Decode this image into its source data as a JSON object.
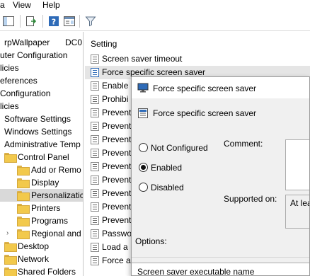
{
  "menu": {
    "items": [
      "a",
      "View",
      "Help"
    ]
  },
  "tree": {
    "items": [
      {
        "label": "rpWallpaper",
        "suffix": "DC0",
        "indent": 0
      },
      {
        "label": "uter Configuration",
        "indent": 0
      },
      {
        "label": "licies",
        "indent": 0
      },
      {
        "label": "eferences",
        "indent": 0
      },
      {
        "label": "Configuration",
        "indent": 0
      },
      {
        "label": "licies",
        "indent": 0
      },
      {
        "label": "Software Settings",
        "indent": 1
      },
      {
        "label": "Windows Settings",
        "indent": 1
      },
      {
        "label": "Administrative Temp",
        "indent": 1
      },
      {
        "label": "Control Panel",
        "indent": 2
      },
      {
        "label": "Add or Remo",
        "indent": 3
      },
      {
        "label": "Display",
        "indent": 3
      },
      {
        "label": "Personalizatic",
        "indent": 3,
        "selected": true
      },
      {
        "label": "Printers",
        "indent": 3
      },
      {
        "label": "Programs",
        "indent": 3
      },
      {
        "label": "Regional and",
        "indent": 3,
        "expander": true
      },
      {
        "label": "Desktop",
        "indent": 2
      },
      {
        "label": "Network",
        "indent": 2
      },
      {
        "label": "Shared Folders",
        "indent": 2
      }
    ]
  },
  "list": {
    "header": "Setting",
    "rows": [
      "Screen saver timeout",
      "Force specific screen saver",
      "Enable",
      "Prohibi",
      "Prevent",
      "Prevent",
      "Prevent",
      "Prevent",
      "Prevent",
      "Prevent",
      "Prevent",
      "Prevent",
      "Prevent",
      "Passwo",
      "Load a",
      "Force a"
    ]
  },
  "dialog": {
    "title": "Force specific screen saver",
    "subtitle": "Force specific screen saver",
    "options": [
      "Not Configured",
      "Enabled",
      "Disabled"
    ],
    "selected_option": "Enabled",
    "comment_label": "Comment:",
    "supported_label": "Supported on:",
    "supported_value": "At lea",
    "options_label": "Options:",
    "field_label": "Screen saver executable name"
  },
  "colors": {
    "folder": "#f2c94c",
    "selection": "#d9d9d9",
    "dialog_bg": "#f0f0f0",
    "accent": "#2e6bb8"
  }
}
